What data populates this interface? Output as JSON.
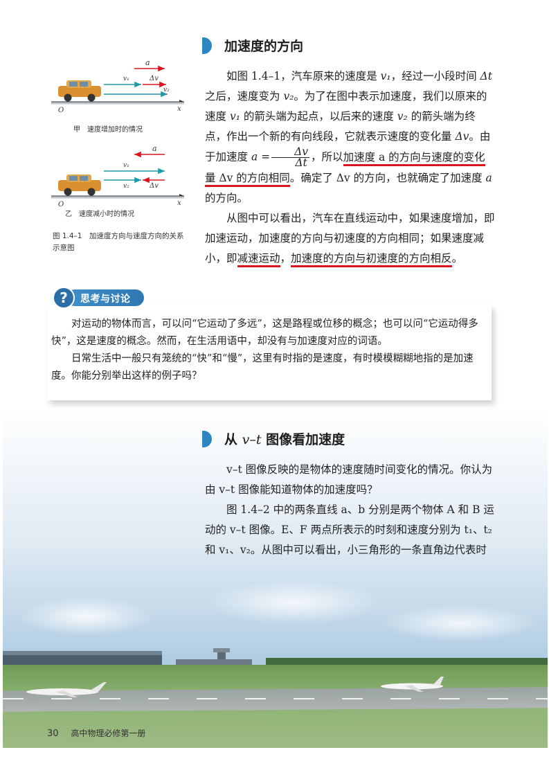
{
  "section1": {
    "title": "加速度的方向",
    "para1_a": "如图 1.4–1，汽车原来的速度是 ",
    "para1_b": "，经过一小段时间 ",
    "para1_c": " 之后，速度变为 ",
    "para1_d": "。为了在图中表示加速度，我们以原来的速度 ",
    "para1_e": " 的箭头端为起点，以后来的速度 ",
    "para1_f": " 的箭头端为终点，作出一个新的有向线段，它就表示速度的变化量 ",
    "para1_g": "。由于加速度 ",
    "para1_h": "，所以",
    "para1_u1": "加速度 a 的方向与速度的变化量 Δv 的方向相同",
    "para1_i": "。确定了 Δv 的方向，也就确定了加速度 ",
    "para1_j": " 的方向。",
    "para2_a": "从图中可以看出，汽车在直线运动中，如果速度增加，即加速运动，加速度的方向与初速度的方向相同；如果速度减小，即",
    "para2_u1": "减速运动",
    "para2_b": "，",
    "para2_u2": "加速度的方向与初速度的方向相反",
    "para2_c": "。",
    "v1": "v₁",
    "v2": "v₂",
    "dt": "Δt",
    "dv": "Δv",
    "a": "a",
    "eq_lhs": "a =",
    "eq_num": "Δv",
    "eq_den": "Δt"
  },
  "figure": {
    "label_a": "a",
    "label_v1": "v₁",
    "label_dv": "Δv",
    "label_v2": "v₂",
    "label_o": "O",
    "label_x": "x",
    "cap_top": "甲　速度增加时的情况",
    "cap_bottom": "乙　速度减小时的情况",
    "caption": "图 1.4–1　加速度方向与速度方向的关系示意图"
  },
  "discussion": {
    "badge": "思考与讨论",
    "badge_icon": "?",
    "p1": "对运动的物体而言，可以问“它运动了多远”，这是路程或位移的概念；也可以问“它运动得多快”，这是速度的概念。然而，在生活用语中，却没有与加速度对应的词语。",
    "p2": "日常生活中一般只有笼统的“快”和“慢”，这里有时指的是速度，有时模模糊糊地指的是加速度。你能分别举出这样的例子吗？"
  },
  "section2": {
    "title_a": "从 ",
    "title_b": "v–t",
    "title_c": " 图像看加速度",
    "p1": "v–t 图像反映的是物体的速度随时间变化的情况。你认为由 v–t 图像能知道物体的加速度吗？",
    "p2": "图 1.4–2 中的两条直线 a、b 分别是两个物体 A 和 B 运动的 v–t 图像。E、F 两点所表示的时刻和速度分别为 t₁、t₂ 和 v₁、v₂。从图中可以看出，小三角形的一条直角边代表时"
  },
  "footer": {
    "page_number": "30",
    "book_title": "高中物理必修第一册"
  },
  "colors": {
    "accent_blue": "#2e86c1",
    "underline_red": "#d8161d",
    "arrow_red": "#d8161d",
    "arrow_teal": "#1f9aa8"
  }
}
